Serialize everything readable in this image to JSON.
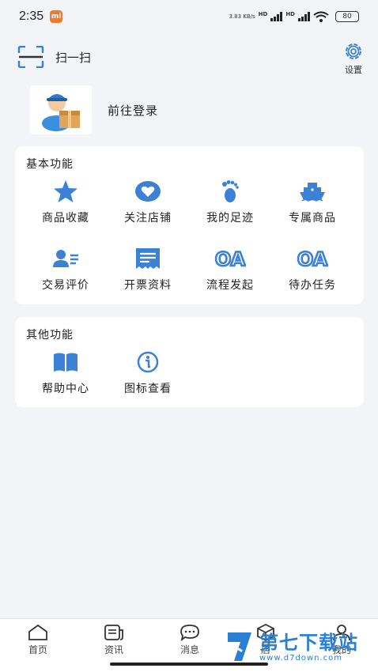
{
  "status_bar": {
    "time": "2:35",
    "mi_badge": "mi",
    "net_speed": "3.83 KB/s",
    "hd1": "HD",
    "hd2": "HD",
    "battery": "80"
  },
  "header": {
    "scan_label": "扫一扫",
    "settings_label": "设置"
  },
  "profile": {
    "login_text": "前往登录"
  },
  "basic": {
    "title": "基本功能",
    "items": [
      {
        "label": "商品收藏",
        "icon": "star-icon"
      },
      {
        "label": "关注店铺",
        "icon": "heart-icon"
      },
      {
        "label": "我的足迹",
        "icon": "footprint-icon"
      },
      {
        "label": "专属商品",
        "icon": "ship-icon"
      },
      {
        "label": "交易评价",
        "icon": "user-review-icon"
      },
      {
        "label": "开票资料",
        "icon": "invoice-icon"
      },
      {
        "label": "流程发起",
        "icon": "oa-icon",
        "text": "OA"
      },
      {
        "label": "待办任务",
        "icon": "oa-icon",
        "text": "OA"
      }
    ]
  },
  "other": {
    "title": "其他功能",
    "items": [
      {
        "label": "帮助中心",
        "icon": "book-icon"
      },
      {
        "label": "图标查看",
        "icon": "info-icon"
      }
    ]
  },
  "tabbar": {
    "items": [
      {
        "label": "首页",
        "icon": "home-icon"
      },
      {
        "label": "资讯",
        "icon": "news-icon"
      },
      {
        "label": "消息",
        "icon": "message-icon"
      },
      {
        "label": "店",
        "icon": "store-icon"
      },
      {
        "label": "我的",
        "icon": "profile-icon"
      }
    ]
  },
  "watermark": {
    "title": "第七下载站",
    "url": "www.d7down.com"
  },
  "colors": {
    "accent": "#3b82d6",
    "background": "#f3f4f7",
    "card": "#ffffff"
  }
}
